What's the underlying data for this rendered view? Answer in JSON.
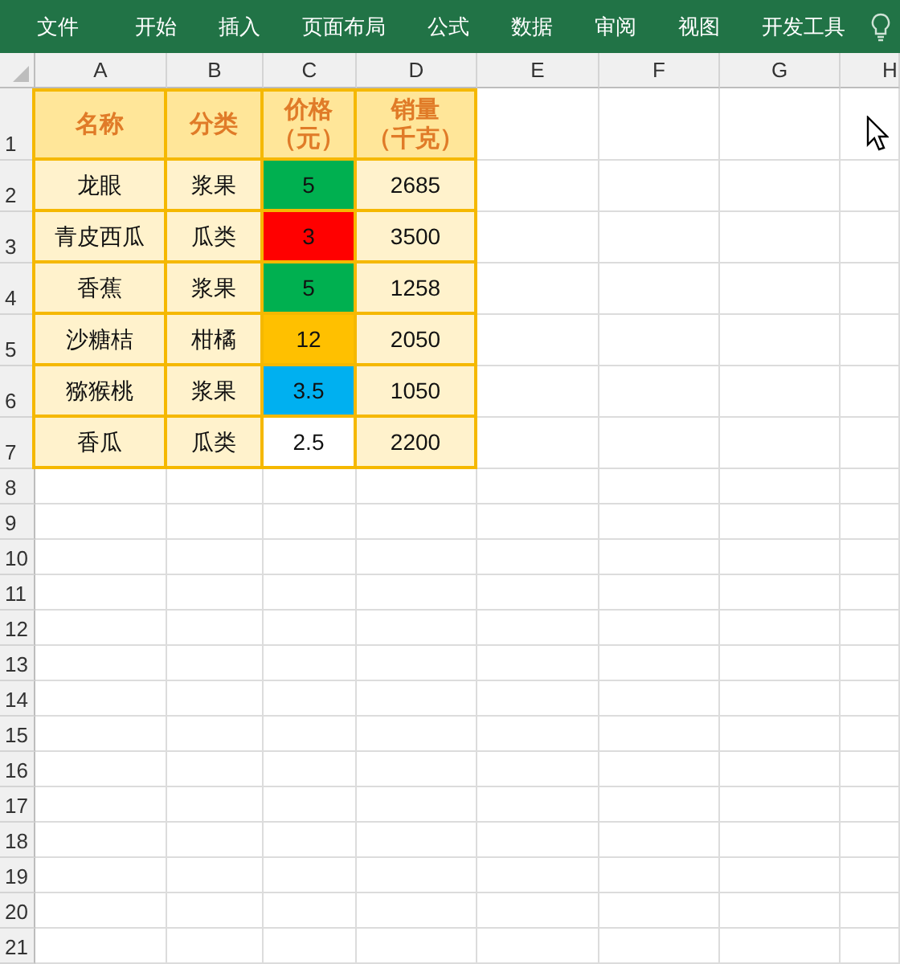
{
  "ribbon": {
    "tabs": [
      "文件",
      "开始",
      "插入",
      "页面布局",
      "公式",
      "数据",
      "审阅",
      "视图",
      "开发工具"
    ]
  },
  "sheet": {
    "columns": [
      "A",
      "B",
      "C",
      "D",
      "E",
      "F",
      "G",
      "H"
    ],
    "row_numbers": [
      "1",
      "2",
      "3",
      "4",
      "5",
      "6",
      "7",
      "8",
      "9",
      "10",
      "11",
      "12",
      "13",
      "14",
      "15",
      "16",
      "17",
      "18",
      "19",
      "20",
      "21"
    ],
    "table": {
      "header": [
        {
          "lines": [
            "名称"
          ]
        },
        {
          "lines": [
            "分类"
          ]
        },
        {
          "lines": [
            "价格",
            "（元）"
          ]
        },
        {
          "lines": [
            "销量",
            "（千克）"
          ]
        }
      ],
      "rows": [
        {
          "name": "龙眼",
          "category": "浆果",
          "price": "5",
          "color": "#00b050",
          "sales": "2685"
        },
        {
          "name": "青皮西瓜",
          "category": "瓜类",
          "price": "3",
          "color": "#ff0000",
          "sales": "3500"
        },
        {
          "name": "香蕉",
          "category": "浆果",
          "price": "5",
          "color": "#00b050",
          "sales": "1258"
        },
        {
          "name": "沙糖桔",
          "category": "柑橘",
          "price": "12",
          "color": "#ffc000",
          "sales": "2050"
        },
        {
          "name": "猕猴桃",
          "category": "浆果",
          "price": "3.5",
          "color": "#00b0f0",
          "sales": "1050"
        },
        {
          "name": "香瓜",
          "category": "瓜类",
          "price": "2.5",
          "color": "#ffffff",
          "sales": "2200"
        }
      ]
    }
  }
}
